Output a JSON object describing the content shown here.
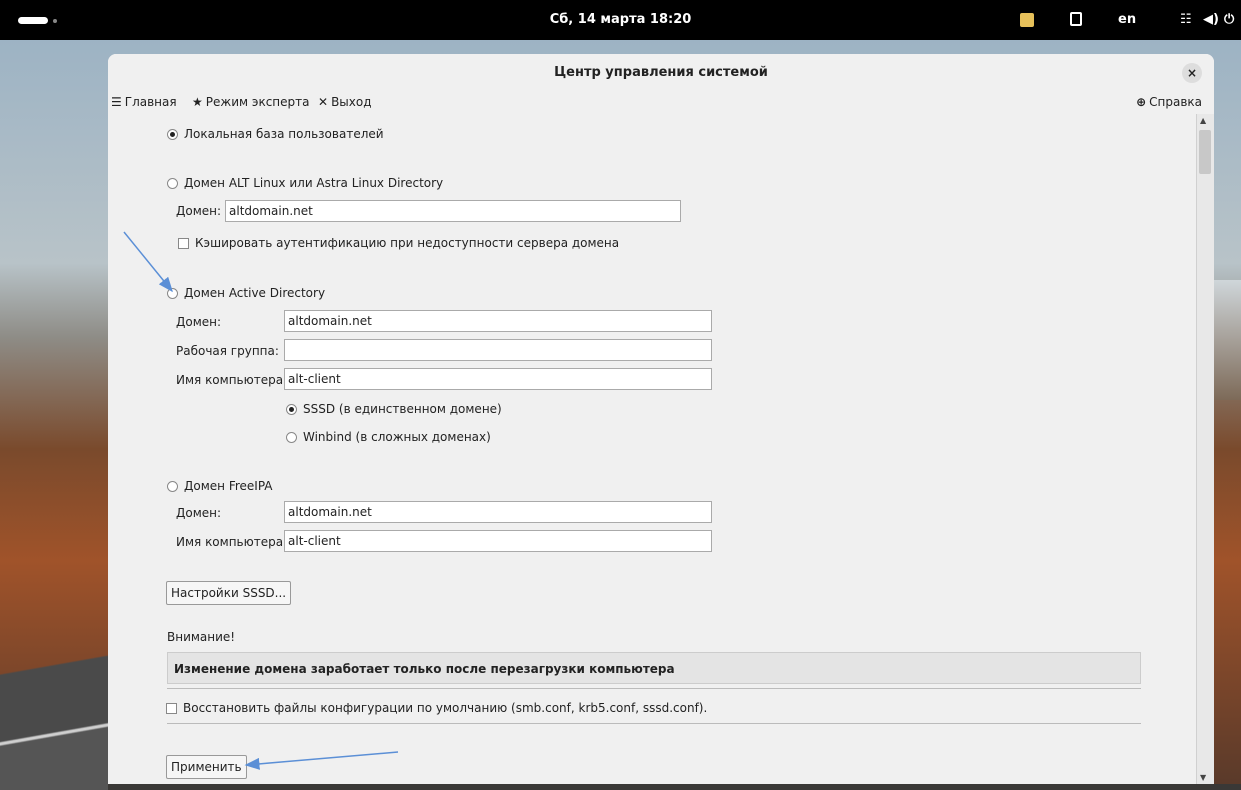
{
  "topbar": {
    "clock": "Сб, 14 марта  18:20",
    "lang": "en",
    "icons": [
      "activities-pill-icon",
      "app-indicator-icon",
      "clipboard-icon",
      "network-icon",
      "volume-icon",
      "power-icon"
    ]
  },
  "window": {
    "title": "Центр управления системой",
    "close": "×"
  },
  "toolbar": {
    "home": "Главная",
    "expert": "Режим эксперта",
    "exit": "Выход",
    "help": "Справка"
  },
  "auth": {
    "local": "Локальная база пользователей",
    "alt": {
      "label": "Домен ALT Linux или Astra Linux Directory",
      "domain_label": "Домен:",
      "domain": "altdomain.net",
      "cache_label": "Кэшировать аутентификацию при недоступности сервера домена"
    },
    "ad": {
      "label": "Домен Active Directory",
      "domain_label": "Домен:",
      "domain": "altdomain.net",
      "workgroup_label": "Рабочая группа:",
      "workgroup": "",
      "hostname_label": "Имя компьютера:",
      "hostname": "alt-client",
      "sssd": "SSSD (в единственном домене)",
      "winbind": "Winbind (в сложных доменах)"
    },
    "freeipa": {
      "label": "Домен FreeIPA",
      "domain_label": "Домен:",
      "domain": "altdomain.net",
      "hostname_label": "Имя компьютера:",
      "hostname": "alt-client"
    },
    "sssd_settings": "Настройки SSSD...",
    "warning_title": "Внимание!",
    "warning_text": "Изменение домена заработает только после перезагрузки компьютера",
    "restore_label": "Восстановить файлы конфигурации по умолчанию (smb.conf, krb5.conf, sssd.conf).",
    "apply": "Применить"
  },
  "colors": {
    "accent_arrow": "#5b8fd6"
  }
}
